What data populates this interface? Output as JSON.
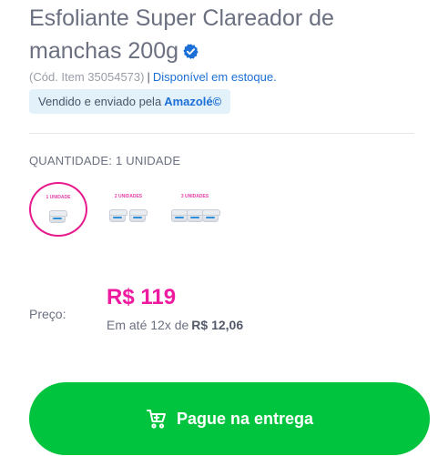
{
  "product": {
    "title": "Esfoliante Super Clareador de manchas 200g",
    "verified_icon": "verified-badge-icon",
    "item_code": "(Cód. Item 35054573)",
    "separator": "|",
    "stock_status": "Disponível em estoque."
  },
  "seller": {
    "prefix": "Vendido e enviado pela",
    "name": "Amazolé©"
  },
  "quantity": {
    "label": "QUANTIDADE:",
    "selected_value": "1 UNIDADE",
    "options": [
      {
        "label": "1 UNIDADE",
        "selected": true
      },
      {
        "label": "2 UNIDADES",
        "selected": false
      },
      {
        "label": "3 UNIDADES",
        "selected": false
      }
    ]
  },
  "pricing": {
    "label": "Preço:",
    "price": "R$ 119",
    "installment_prefix": "Em até 12x de",
    "installment_amount": "R$ 12,06"
  },
  "cta": {
    "label": "Pague na entrega",
    "icon": "cart-icon"
  },
  "colors": {
    "accent_pink": "#ee1aa0",
    "cta_green": "#00c43d",
    "link_blue": "#1b6fd6"
  }
}
